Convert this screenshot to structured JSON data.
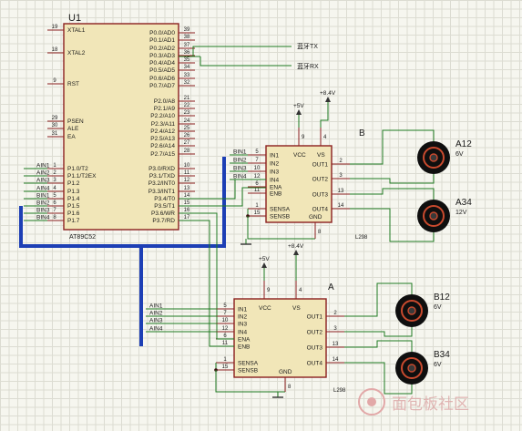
{
  "mcu": {
    "ref": "U1",
    "part": "AT89C52",
    "left_pins": [
      {
        "num": "19",
        "name": "XTAL1"
      },
      {
        "num": "18",
        "name": "XTAL2"
      },
      {
        "num": "9",
        "name": "RST"
      },
      {
        "num": "29",
        "name": "PSEN"
      },
      {
        "num": "30",
        "name": "ALE"
      },
      {
        "num": "31",
        "name": "EA"
      },
      {
        "num": "1",
        "name": "P1.0/T2"
      },
      {
        "num": "2",
        "name": "P1.1/T2EX"
      },
      {
        "num": "3",
        "name": "P1.2"
      },
      {
        "num": "4",
        "name": "P1.3"
      },
      {
        "num": "5",
        "name": "P1.4"
      },
      {
        "num": "6",
        "name": "P1.5"
      },
      {
        "num": "7",
        "name": "P1.6"
      },
      {
        "num": "8",
        "name": "P1.7"
      }
    ],
    "right_pins": [
      {
        "num": "39",
        "name": "P0.0/AD0"
      },
      {
        "num": "38",
        "name": "P0.1/AD1"
      },
      {
        "num": "37",
        "name": "P0.2/AD2"
      },
      {
        "num": "36",
        "name": "P0.3/AD3"
      },
      {
        "num": "35",
        "name": "P0.4/AD4"
      },
      {
        "num": "34",
        "name": "P0.5/AD5"
      },
      {
        "num": "33",
        "name": "P0.6/AD6"
      },
      {
        "num": "32",
        "name": "P0.7/AD7"
      },
      {
        "num": "21",
        "name": "P2.0/A8"
      },
      {
        "num": "22",
        "name": "P2.1/A9"
      },
      {
        "num": "23",
        "name": "P2.2/A10"
      },
      {
        "num": "24",
        "name": "P2.3/A11"
      },
      {
        "num": "25",
        "name": "P2.4/A12"
      },
      {
        "num": "26",
        "name": "P2.5/A13"
      },
      {
        "num": "27",
        "name": "P2.6/A14"
      },
      {
        "num": "28",
        "name": "P2.7/A15"
      },
      {
        "num": "10",
        "name": "P3.0/RXD"
      },
      {
        "num": "11",
        "name": "P3.1/TXD"
      },
      {
        "num": "12",
        "name": "P3.2/INT0"
      },
      {
        "num": "13",
        "name": "P3.3/INT1"
      },
      {
        "num": "14",
        "name": "P3.4/T0"
      },
      {
        "num": "15",
        "name": "P3.5/T1"
      },
      {
        "num": "16",
        "name": "P3.6/WR"
      },
      {
        "num": "17",
        "name": "P3.7/RD"
      }
    ],
    "port1_nets": [
      "AIN1",
      "AIN2",
      "AIN3",
      "AIN4",
      "BIN1",
      "BIN2",
      "BIN3",
      "BIN4"
    ]
  },
  "bluetooth": {
    "tx": "蓝牙TX",
    "rx": "蓝牙RX"
  },
  "driver_b": {
    "label": "B",
    "part": "L298",
    "vcc_rail": "+5V",
    "vs_rail": "+8.4V",
    "vcc_pin": "9",
    "vs_pin": "4",
    "gnd_pin": "8",
    "inputs": [
      {
        "pin": "5",
        "name": "IN1",
        "net": "BIN1"
      },
      {
        "pin": "7",
        "name": "IN2",
        "net": "BIN2"
      },
      {
        "pin": "10",
        "name": "IN3",
        "net": "BIN3"
      },
      {
        "pin": "12",
        "name": "IN4",
        "net": "BIN4"
      }
    ],
    "enables": [
      {
        "pin": "6",
        "name": "ENA"
      },
      {
        "pin": "11",
        "name": "ENB"
      }
    ],
    "sense": [
      {
        "pin": "1",
        "name": "SENSA"
      },
      {
        "pin": "15",
        "name": "SENSB"
      }
    ],
    "outputs": [
      {
        "pin": "2",
        "name": "OUT1"
      },
      {
        "pin": "3",
        "name": "OUT2"
      },
      {
        "pin": "13",
        "name": "OUT3"
      },
      {
        "pin": "14",
        "name": "OUT4"
      }
    ],
    "vcc_name": "VCC",
    "vs_name": "VS",
    "gnd_name": "GND"
  },
  "driver_a": {
    "label": "A",
    "part": "L298",
    "vcc_rail": "+5V",
    "vs_rail": "+8.4V",
    "vcc_pin": "9",
    "vs_pin": "4",
    "gnd_pin": "8",
    "inputs": [
      {
        "pin": "5",
        "name": "IN1",
        "net": "AIN1"
      },
      {
        "pin": "7",
        "name": "IN2",
        "net": "AIN2"
      },
      {
        "pin": "10",
        "name": "IN3",
        "net": "AIN3"
      },
      {
        "pin": "12",
        "name": "IN4",
        "net": "AIN4"
      }
    ],
    "enables": [
      {
        "pin": "6",
        "name": "ENA"
      },
      {
        "pin": "11",
        "name": "ENB"
      }
    ],
    "sense": [
      {
        "pin": "1",
        "name": "SENSA"
      },
      {
        "pin": "15",
        "name": "SENSB"
      }
    ],
    "outputs": [
      {
        "pin": "2",
        "name": "OUT1"
      },
      {
        "pin": "3",
        "name": "OUT2"
      },
      {
        "pin": "13",
        "name": "OUT3"
      },
      {
        "pin": "14",
        "name": "OUT4"
      }
    ],
    "vcc_name": "VCC",
    "vs_name": "VS",
    "gnd_name": "GND"
  },
  "motors": [
    {
      "ref": "A12",
      "value": "6V"
    },
    {
      "ref": "A34",
      "value": "12V"
    },
    {
      "ref": "B12",
      "value": "6V"
    },
    {
      "ref": "B34",
      "value": "6V"
    }
  ],
  "watermark": "面包板社区",
  "colors": {
    "wire": "#1f7a22",
    "body": "#8b1f1f",
    "bus": "#1d3fb5",
    "pin": "#8b1f1f",
    "netlabel": "#c0392b"
  }
}
